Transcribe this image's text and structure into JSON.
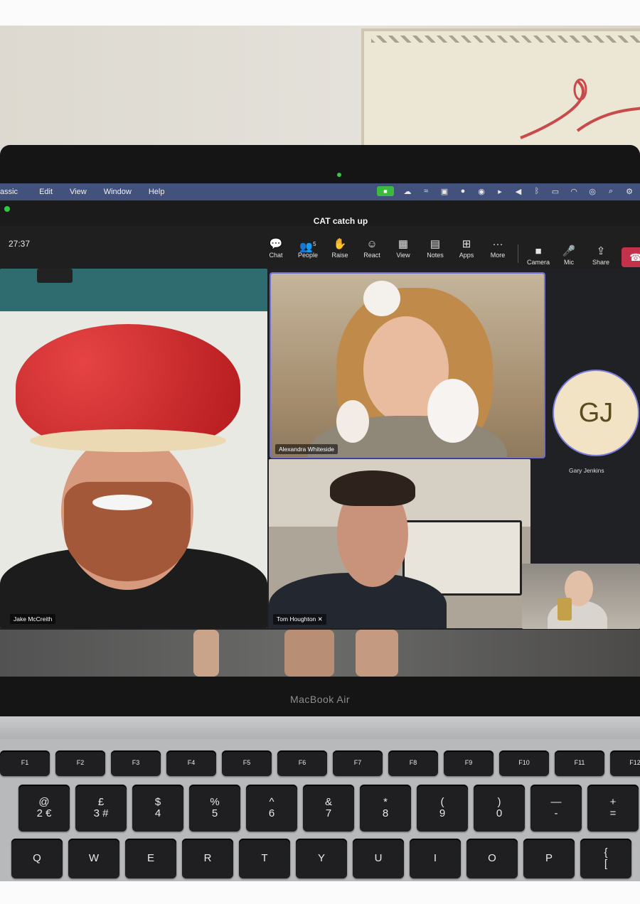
{
  "menubar": {
    "items": [
      "assic",
      "Edit",
      "View",
      "Window",
      "Help"
    ]
  },
  "meeting": {
    "title": "CAT catch up",
    "timer": "27:37"
  },
  "toolbar": {
    "chat": "Chat",
    "people": "People",
    "people_count": "5",
    "raise": "Raise",
    "react": "React",
    "view": "View",
    "notes": "Notes",
    "apps": "Apps",
    "more": "More",
    "camera": "Camera",
    "mic": "Mic",
    "share": "Share"
  },
  "participants": {
    "jake": "Jake McCreith",
    "alexandra": "Alexandra Whiteside",
    "tom": "Tom Houghton",
    "gary": "Gary Jenkins",
    "gary_initials": "GJ"
  },
  "laptop": {
    "brand": "MacBook Air"
  },
  "keyboard": {
    "fn_row": [
      "F1",
      "F2",
      "F3",
      "F4",
      "F5",
      "F6",
      "F7",
      "F8",
      "F9",
      "F10",
      "F11",
      "F12"
    ],
    "number_row": [
      "@\n2 €",
      "£\n3 #",
      "$\n4",
      "%\n5",
      "^\n6",
      "&\n7",
      "*\n8",
      "(\n9",
      ")\n0",
      "—\n-",
      "+\n="
    ],
    "letter_row": [
      "Q",
      "W",
      "E",
      "R",
      "T",
      "Y",
      "U",
      "I",
      "O",
      "P",
      "{\n["
    ]
  },
  "colors": {
    "menubar": "#43517d",
    "leave_button": "#c4314b",
    "active_speaker_border": "#6e6fd0",
    "camera_indicator": "#3bba3f"
  }
}
